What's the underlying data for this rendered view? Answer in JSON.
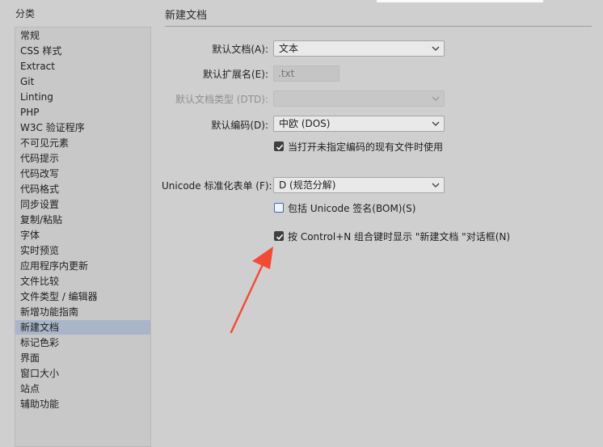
{
  "sidebar": {
    "title": "分类",
    "items": [
      {
        "label": "常规"
      },
      {
        "label": "CSS 样式"
      },
      {
        "label": "Extract"
      },
      {
        "label": "Git"
      },
      {
        "label": "Linting"
      },
      {
        "label": "PHP"
      },
      {
        "label": "W3C 验证程序"
      },
      {
        "label": "不可见元素"
      },
      {
        "label": "代码提示"
      },
      {
        "label": "代码改写"
      },
      {
        "label": "代码格式"
      },
      {
        "label": "同步设置"
      },
      {
        "label": "复制/粘贴"
      },
      {
        "label": "字体"
      },
      {
        "label": "实时预览"
      },
      {
        "label": "应用程序内更新"
      },
      {
        "label": "文件比较"
      },
      {
        "label": "文件类型 / 编辑器"
      },
      {
        "label": "新增功能指南"
      },
      {
        "label": "新建文档"
      },
      {
        "label": "标记色彩"
      },
      {
        "label": "界面"
      },
      {
        "label": "窗口大小"
      },
      {
        "label": "站点"
      },
      {
        "label": "辅助功能"
      }
    ],
    "selected_index": 19
  },
  "panel": {
    "title": "新建文档",
    "default_doc_label": "默认文档(A):",
    "default_doc_value": "文本",
    "default_ext_label": "默认扩展名(E):",
    "default_ext_placeholder": ".txt",
    "default_dtd_label": "默认文档类型 (DTD):",
    "default_dtd_value": "",
    "default_encoding_label": "默认编码(D):",
    "default_encoding_value": "中欧 (DOS)",
    "use_when_no_encoding_label": "当打开未指定编码的现有文件时使用",
    "use_when_no_encoding_checked": true,
    "unicode_form_label": "Unicode 标准化表单 (F):",
    "unicode_form_value": "D (规范分解)",
    "include_bom_label": "包括  Unicode 签名(BOM)(S)",
    "include_bom_checked": false,
    "show_dialog_label": "按  Control+N 组合键时显示 \"新建文档 \"对话框(N)",
    "show_dialog_checked": true
  },
  "colors": {
    "background": "#cfcfcf",
    "selected_item": "#a9b6c9",
    "annotation_arrow": "#f24a35"
  }
}
